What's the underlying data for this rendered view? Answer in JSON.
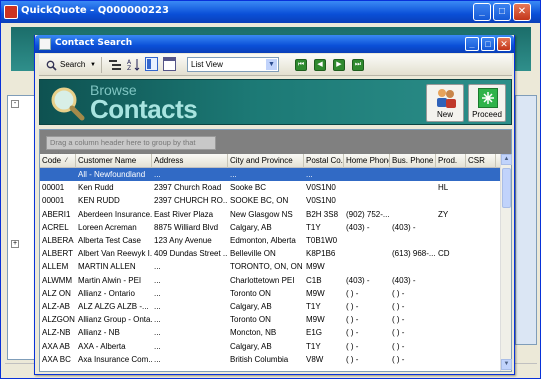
{
  "outer": {
    "title": "QuickQuote - Q000000223",
    "buttons": {
      "minimize": "_",
      "maximize": "□",
      "close": "✕"
    }
  },
  "dialog": {
    "title": "Contact Search",
    "buttons": {
      "minimize": "_",
      "maximize": "□",
      "close": "✕"
    }
  },
  "toolbar": {
    "search_label": "Search",
    "view_selected": "List View",
    "icons": [
      "search-icon",
      "dropdown-arrow-icon",
      "group-icon",
      "sort-icon",
      "panel-icon",
      "window-icon",
      "first-icon",
      "prev-icon",
      "next-icon",
      "last-icon"
    ]
  },
  "banner": {
    "line1": "Browse",
    "line2": "Contacts",
    "new_label": "New",
    "proceed_label": "Proceed"
  },
  "grid": {
    "group_hint": "Drag a column header here to group by that column.",
    "columns": [
      "Code",
      "Customer Name",
      "Address",
      "City and Province",
      "Postal Co...",
      "Home Phone",
      "Bus. Phone",
      "Prod.",
      "CSR"
    ],
    "rows": [
      [
        "",
        "All - Newfoundland",
        "...",
        "...",
        "...",
        "",
        "",
        "",
        ""
      ],
      [
        "00001",
        "Ken Rudd",
        "2397 Church Road",
        "Sooke BC",
        "V0S1N0",
        "",
        "",
        "HL",
        ""
      ],
      [
        "00001",
        "KEN RUDD",
        "2397 CHURCH RO...",
        "SOOKE BC, ON",
        "V0S1N0",
        "",
        "",
        "",
        ""
      ],
      [
        "ABERI1",
        "Aberdeen Insurance...",
        "East River Plaza",
        "New Glasgow NS",
        "B2H 3S8",
        "(902) 752-...",
        "",
        "ZY",
        ""
      ],
      [
        "ACREL",
        "Loreen Acreman",
        "8875 Williard Blvd",
        "Calgary, AB",
        "T1Y",
        "(403)  -",
        "(403)  -",
        "",
        ""
      ],
      [
        "ALBERA",
        "Alberta Test Case",
        "123 Any Avenue",
        "Edmonton, Alberta",
        "T0B1W0",
        "",
        "",
        "",
        ""
      ],
      [
        "ALBERT",
        "Albert Van Reewyk I...",
        "409 Dundas Street ...",
        "Belleville ON",
        "K8P1B6",
        "",
        "(613) 968-...",
        "CD",
        ""
      ],
      [
        "ALLEM",
        "MARTIN ALLEN",
        "...",
        "TORONTO, ON, ON",
        "M9W",
        "",
        "",
        "",
        ""
      ],
      [
        "ALWMM",
        "Martin Alwin  - PEI",
        "...",
        "Charlottetown PEI",
        "C1B",
        "(403)  -",
        "(403)  -",
        "",
        ""
      ],
      [
        "ALZ ON",
        "Allianz - Ontario",
        "...",
        "Toronto ON",
        "M9W",
        "(  )  -",
        "(  )  -",
        "",
        ""
      ],
      [
        "ALZ-AB",
        "ALZ ALZG ALZB -...",
        "...",
        "Calgary, AB",
        "T1Y",
        "(  )  -",
        "(  )  -",
        "",
        ""
      ],
      [
        "ALZGON",
        "Allianz Group - Onta...",
        "...",
        "Toronto ON",
        "M9W",
        "(  )  -",
        "(  )  -",
        "",
        ""
      ],
      [
        "ALZ-NB",
        "Allianz - NB",
        "...",
        "Moncton, NB",
        "E1G",
        "(  )  -",
        "(  )  -",
        "",
        ""
      ],
      [
        "AXA AB",
        "AXA - Alberta",
        "...",
        "Calgary, AB",
        "T1Y",
        "(  )  -",
        "(  )  -",
        "",
        ""
      ],
      [
        "AXA BC",
        "Axa Insurance Com...",
        "...",
        "British Columbia",
        "V8W",
        "(  )  -",
        "(  )  -",
        "",
        ""
      ]
    ]
  }
}
